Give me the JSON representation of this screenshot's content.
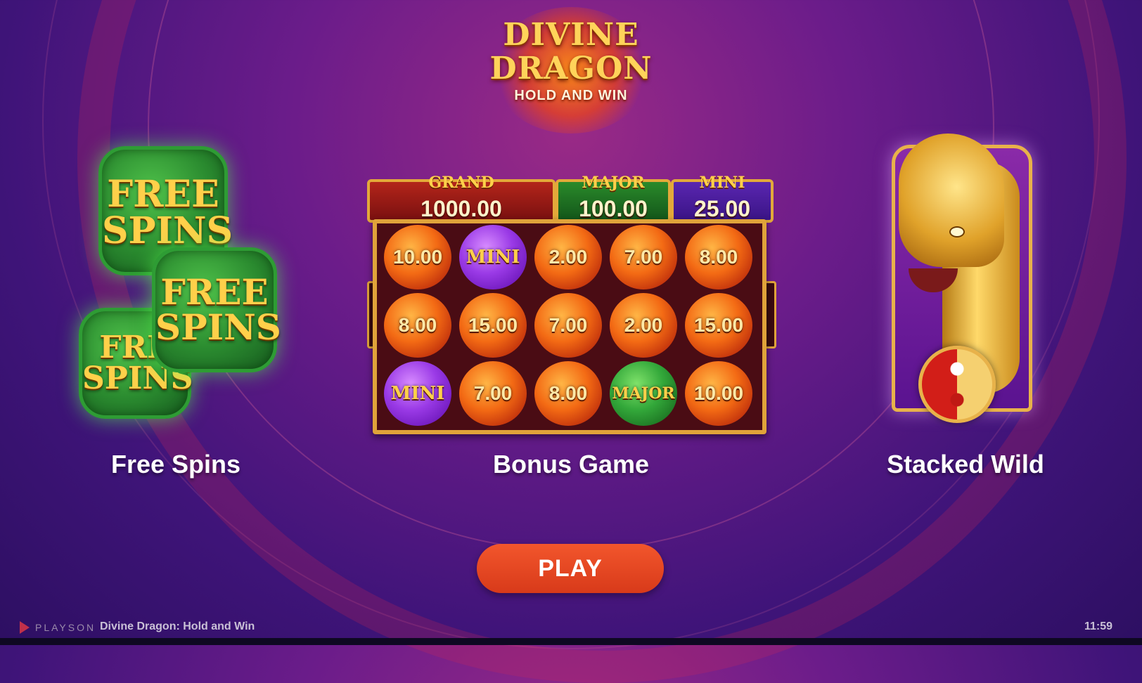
{
  "logo": {
    "line1": "DIVINE",
    "line2": "DRAGON",
    "line3": "HOLD AND WIN"
  },
  "features": {
    "free_spins": {
      "label": "Free Spins",
      "tile_line1": "FREE",
      "tile_line2": "SPINS",
      "tile_line1_partial": "FRE"
    },
    "bonus_game": {
      "label": "Bonus Game"
    },
    "stacked_wild": {
      "label": "Stacked Wild"
    }
  },
  "jackpots": [
    {
      "name": "GRAND",
      "value": "1000.00"
    },
    {
      "name": "MAJOR",
      "value": "100.00"
    },
    {
      "name": "MINI",
      "value": "25.00"
    }
  ],
  "grid": [
    [
      {
        "text": "10.00",
        "kind": "fire"
      },
      {
        "text": "MINI",
        "kind": "purple"
      },
      {
        "text": "2.00",
        "kind": "fire"
      },
      {
        "text": "7.00",
        "kind": "fire"
      },
      {
        "text": "8.00",
        "kind": "fire"
      }
    ],
    [
      {
        "text": "8.00",
        "kind": "fire"
      },
      {
        "text": "15.00",
        "kind": "fire"
      },
      {
        "text": "7.00",
        "kind": "fire"
      },
      {
        "text": "2.00",
        "kind": "fire"
      },
      {
        "text": "15.00",
        "kind": "fire"
      }
    ],
    [
      {
        "text": "MINI",
        "kind": "purple"
      },
      {
        "text": "7.00",
        "kind": "fire"
      },
      {
        "text": "8.00",
        "kind": "fire"
      },
      {
        "text": "MAJOR",
        "kind": "green"
      },
      {
        "text": "10.00",
        "kind": "fire"
      }
    ]
  ],
  "play_button": {
    "label": "PLAY"
  },
  "footer": {
    "provider": "PLAYSON",
    "game_name": "Divine Dragon: Hold and Win",
    "clock": "11:59"
  },
  "colors": {
    "play": "#e94a22",
    "gold": "#ffd04a",
    "background": "#5a1a8a"
  }
}
